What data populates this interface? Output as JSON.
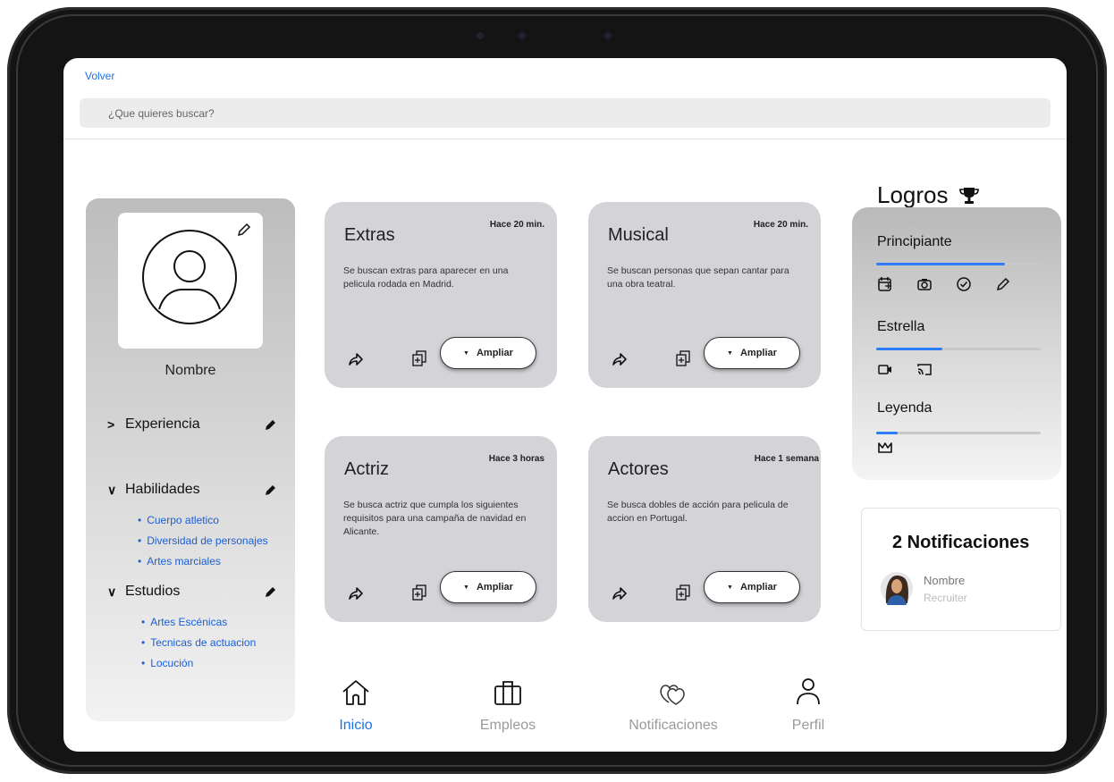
{
  "header": {
    "back_label": "Volver",
    "search_placeholder": "¿Que quieres buscar?"
  },
  "profile": {
    "name": "Nombre",
    "sections": [
      {
        "title": "Experiencia",
        "expanded": false,
        "items": []
      },
      {
        "title": "Habilidades",
        "expanded": true,
        "items": [
          "Cuerpo atletico",
          "Diversidad de personajes",
          "Artes marciales"
        ]
      },
      {
        "title": "Estudios",
        "expanded": true,
        "items": [
          "Artes Escénicas",
          "Tecnicas de actuacion",
          "Locución"
        ]
      }
    ]
  },
  "cards": [
    {
      "title": "Extras",
      "time": "Hace 20 min.",
      "description": "Se buscan extras para aparecer en una pelicula rodada en Madrid.",
      "button": "Ampliar"
    },
    {
      "title": "Musical",
      "time": "Hace 20 min.",
      "description": "Se buscan personas que sepan cantar para una obra teatral.",
      "button": "Ampliar"
    },
    {
      "title": "Actriz",
      "time": "Hace 3 horas",
      "description": "Se busca actriz que cumpla los siguientes requisitos para una campaña de navidad en Alicante.",
      "button": "Ampliar"
    },
    {
      "title": "Actores",
      "time": "Hace 1 semana",
      "description": "Se busca dobles de acción para pelicula de accion en Portugal.",
      "button": "Ampliar"
    }
  ],
  "nav": {
    "items": [
      {
        "label": "Inicio",
        "icon": "home-icon",
        "active": true
      },
      {
        "label": "Empleos",
        "icon": "briefcase-icon",
        "active": false
      },
      {
        "label": "Notificaciones",
        "icon": "hearts-icon",
        "active": false
      },
      {
        "label": "Perfil",
        "icon": "user-icon",
        "active": false
      }
    ]
  },
  "logros": {
    "title": "Logros",
    "levels": [
      {
        "name": "Principiante",
        "progress": 0.78,
        "icons": [
          "calendar-icon",
          "camera-icon",
          "check-circle-icon",
          "pencil-icon"
        ]
      },
      {
        "name": "Estrella",
        "progress": 0.4,
        "icons": [
          "video-icon",
          "cast-icon"
        ]
      },
      {
        "name": "Leyenda",
        "progress": 0.13,
        "icons": [
          "crown-icon"
        ]
      }
    ]
  },
  "notifications": {
    "title": "2 Notificaciones",
    "items": [
      {
        "name": "Nombre",
        "role": "Recruiter"
      }
    ]
  },
  "colors": {
    "accent": "#1a73e8",
    "card_bg": "#d3d3d8",
    "progress": "#2f7df6"
  }
}
